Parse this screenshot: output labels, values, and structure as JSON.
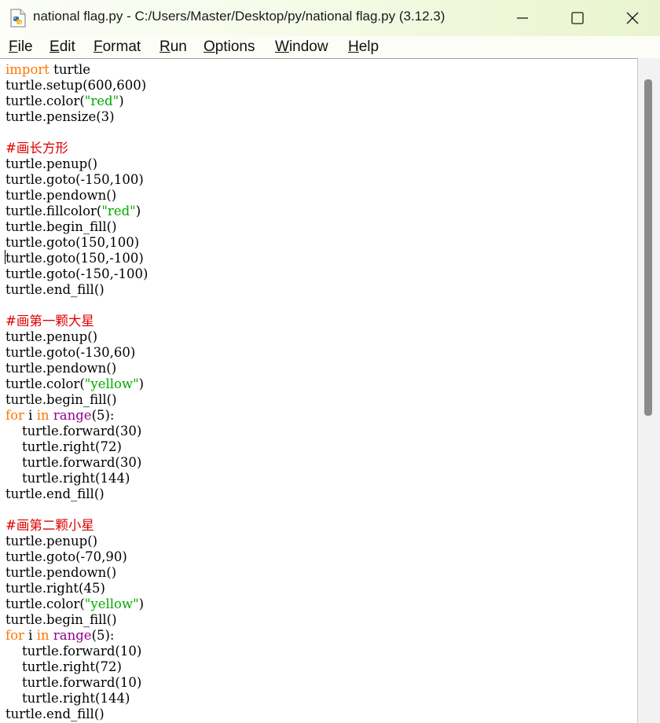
{
  "window": {
    "title": "national flag.py - C:/Users/Master/Desktop/py/national flag.py (3.12.3)",
    "controls": [
      "minimize",
      "maximize",
      "close"
    ]
  },
  "menu": [
    {
      "label": "File"
    },
    {
      "label": "Edit"
    },
    {
      "label": "Format"
    },
    {
      "label": "Run"
    },
    {
      "label": "Options"
    },
    {
      "label": "Window"
    },
    {
      "label": "Help"
    }
  ],
  "colors": {
    "keyword": "#ff7700",
    "builtin": "#900090",
    "string": "#00aa00",
    "comment": "#dd0000",
    "text": "#000000"
  },
  "editor": {
    "cursor_line": 13,
    "lines": [
      [
        {
          "t": "kw",
          "v": "import"
        },
        {
          "t": "p",
          "v": " turtle"
        }
      ],
      [
        {
          "t": "p",
          "v": "turtle.setup(600,600)"
        }
      ],
      [
        {
          "t": "p",
          "v": "turtle.color("
        },
        {
          "t": "str",
          "v": "\"red\""
        },
        {
          "t": "p",
          "v": ")"
        }
      ],
      [
        {
          "t": "p",
          "v": "turtle.pensize(3)"
        }
      ],
      [],
      [
        {
          "t": "cmt",
          "v": "#画长方形"
        }
      ],
      [
        {
          "t": "p",
          "v": "turtle.penup()"
        }
      ],
      [
        {
          "t": "p",
          "v": "turtle.goto(-150,100)"
        }
      ],
      [
        {
          "t": "p",
          "v": "turtle.pendown()"
        }
      ],
      [
        {
          "t": "p",
          "v": "turtle.fillcolor("
        },
        {
          "t": "str",
          "v": "\"red\""
        },
        {
          "t": "p",
          "v": ")"
        }
      ],
      [
        {
          "t": "p",
          "v": "turtle.begin_fill()"
        }
      ],
      [
        {
          "t": "p",
          "v": "turtle.goto(150,100)"
        }
      ],
      [
        {
          "t": "p",
          "v": "turtle.goto(150,-100)"
        }
      ],
      [
        {
          "t": "p",
          "v": "turtle.goto(-150,-100)"
        }
      ],
      [
        {
          "t": "p",
          "v": "turtle.end_fill()"
        }
      ],
      [],
      [
        {
          "t": "cmt",
          "v": "#画第一颗大星"
        }
      ],
      [
        {
          "t": "p",
          "v": "turtle.penup()"
        }
      ],
      [
        {
          "t": "p",
          "v": "turtle.goto(-130,60)"
        }
      ],
      [
        {
          "t": "p",
          "v": "turtle.pendown()"
        }
      ],
      [
        {
          "t": "p",
          "v": "turtle.color("
        },
        {
          "t": "str",
          "v": "\"yellow\""
        },
        {
          "t": "p",
          "v": ")"
        }
      ],
      [
        {
          "t": "p",
          "v": "turtle.begin_fill()"
        }
      ],
      [
        {
          "t": "kw",
          "v": "for"
        },
        {
          "t": "p",
          "v": " i "
        },
        {
          "t": "kw",
          "v": "in"
        },
        {
          "t": "p",
          "v": " "
        },
        {
          "t": "bi",
          "v": "range"
        },
        {
          "t": "p",
          "v": "(5):"
        }
      ],
      [
        {
          "t": "p",
          "v": "    turtle.forward(30)"
        }
      ],
      [
        {
          "t": "p",
          "v": "    turtle.right(72)"
        }
      ],
      [
        {
          "t": "p",
          "v": "    turtle.forward(30)"
        }
      ],
      [
        {
          "t": "p",
          "v": "    turtle.right(144)"
        }
      ],
      [
        {
          "t": "p",
          "v": "turtle.end_fill()"
        }
      ],
      [],
      [
        {
          "t": "cmt",
          "v": "#画第二颗小星"
        }
      ],
      [
        {
          "t": "p",
          "v": "turtle.penup()"
        }
      ],
      [
        {
          "t": "p",
          "v": "turtle.goto(-70,90)"
        }
      ],
      [
        {
          "t": "p",
          "v": "turtle.pendown()"
        }
      ],
      [
        {
          "t": "p",
          "v": "turtle.right(45)"
        }
      ],
      [
        {
          "t": "p",
          "v": "turtle.color("
        },
        {
          "t": "str",
          "v": "\"yellow\""
        },
        {
          "t": "p",
          "v": ")"
        }
      ],
      [
        {
          "t": "p",
          "v": "turtle.begin_fill()"
        }
      ],
      [
        {
          "t": "kw",
          "v": "for"
        },
        {
          "t": "p",
          "v": " i "
        },
        {
          "t": "kw",
          "v": "in"
        },
        {
          "t": "p",
          "v": " "
        },
        {
          "t": "bi",
          "v": "range"
        },
        {
          "t": "p",
          "v": "(5):"
        }
      ],
      [
        {
          "t": "p",
          "v": "    turtle.forward(10)"
        }
      ],
      [
        {
          "t": "p",
          "v": "    turtle.right(72)"
        }
      ],
      [
        {
          "t": "p",
          "v": "    turtle.forward(10)"
        }
      ],
      [
        {
          "t": "p",
          "v": "    turtle.right(144)"
        }
      ],
      [
        {
          "t": "p",
          "v": "turtle.end_fill()"
        }
      ]
    ]
  }
}
